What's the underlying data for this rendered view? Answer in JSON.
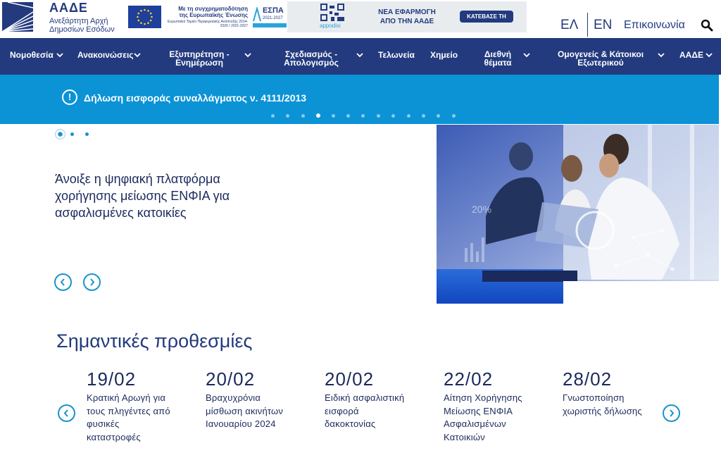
{
  "header": {
    "logo_title": "ΑΑΔΕ",
    "logo_sub_1": "Ανεξάρτητη Αρχή",
    "logo_sub_2": "Δημοσίων Εσόδων",
    "eu_text_1": "Με τη συγχρηματοδότηση",
    "eu_text_2": "της Ευρωπαϊκής Ένωσης",
    "eu_text_3": "Ευρωπαϊκό Ταμείο Περιφερειακής Ανάπτυξης 2014-2020 / 2021-2027",
    "espa_label": "ΕΣΠΑ",
    "espa_years": "2021-2027",
    "app_name": "appodixi",
    "app_banner_title_1": "ΝΕΑ ΕΦΑΡΜΟΓΗ",
    "app_banner_title_2": "ΑΠΟ ΤΗΝ ΑΑΔΕ",
    "app_banner_button": "ΚΑΤΕΒΑΣΕ ΤΗ",
    "lang_el": "ΕΛ",
    "lang_en": "EN",
    "contact": "Επικοινωνία"
  },
  "nav": {
    "items": [
      {
        "line1": "Νομοθεσία",
        "line2": ""
      },
      {
        "line1": "Ανακοινώσεις",
        "line2": ""
      },
      {
        "line1": "Εξυπηρέτηση -",
        "line2": "Ενημέρωση"
      },
      {
        "line1": "Σχεδιασμός -",
        "line2": "Απολογισμός"
      },
      {
        "line1": "Τελωνεία",
        "line2": ""
      },
      {
        "line1": "Χημείο",
        "line2": ""
      },
      {
        "line1": "Διεθνή",
        "line2": "θέματα"
      },
      {
        "line1": "Ομογενείς & Κάτοικοι",
        "line2": "Εξωτερικού"
      },
      {
        "line1": "ΑΑΔΕ",
        "line2": ""
      }
    ]
  },
  "alert": {
    "icon": "!",
    "text": "Δήλωση εισφοράς συναλλάγματος ν. 4111/2013",
    "dot_count": 13,
    "active_dot": 3
  },
  "slider": {
    "title_line1": "Άνοιξε η ψηφιακή πλατφόρμα",
    "title_line2": "χορήγησης μείωσης ΕΝΦΙΑ για",
    "title_line3": "ασφαλισμένες κατοικίες",
    "dot_count": 3,
    "active_dot": 0
  },
  "deadlines": {
    "title": "Σημαντικές προθεσμίες",
    "items": [
      {
        "date": "19/02",
        "l1": "Κρατική Αρωγή για",
        "l2": "τους πληγέντες από",
        "l3": "φυσικές",
        "l4": "καταστροφές"
      },
      {
        "date": "20/02",
        "l1": "Βραχυχρόνια",
        "l2": "μίσθωση ακινήτων",
        "l3": "Ιανουαρίου 2024",
        "l4": ""
      },
      {
        "date": "20/02",
        "l1": "Ειδική ασφαλιστική",
        "l2": "εισφορά",
        "l3": "δακοκτονίας",
        "l4": ""
      },
      {
        "date": "22/02",
        "l1": "Αίτηση Χορήγησης",
        "l2": "Μείωσης ΕΝΦΙΑ",
        "l3": "Ασφαλισμένων",
        "l4": "Κατοικιών"
      },
      {
        "date": "28/02",
        "l1": "Γνωστοποίηση",
        "l2": "χωριστής δήλωσης",
        "l3": "",
        "l4": ""
      }
    ]
  },
  "colors": {
    "navy": "#233a7e",
    "alert_blue": "#0b93d6",
    "accent_cyan": "#1a93c9"
  }
}
